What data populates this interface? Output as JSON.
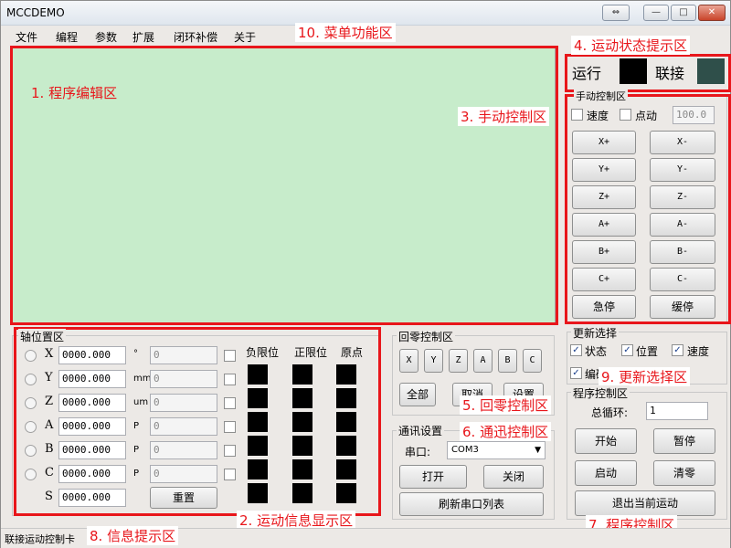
{
  "window": {
    "title": "MCCDEMO",
    "controls": {
      "restore": "⇔",
      "minimize": "—",
      "maximize": "□",
      "close": "✕"
    }
  },
  "menu": [
    "文件",
    "编程",
    "参数",
    "扩展",
    "闭环补偿",
    "关于"
  ],
  "annotations": {
    "menu_area": "10. 菜单功能区",
    "status_area": "4. 运动状态提示区",
    "editor_area": "1. 程序编辑区",
    "manual_area": "3. 手动控制区",
    "motion_info_area": "2. 运动信息显示区",
    "homing_area": "5. 回零控制区",
    "comm_area": "6. 通迅控制区",
    "program_area": "7. 程序控制区",
    "info_area": "8. 信息提示区",
    "update_area": "9. 更新选择区"
  },
  "status": {
    "run_label": "运行",
    "run_color": "#000000",
    "link_label": "联接",
    "link_color": "#2f4f4a"
  },
  "manual": {
    "title": "手动控制区",
    "speed_label": "速度",
    "jog_label": "点动",
    "speed_value": "100.0",
    "buttons": [
      [
        "X+",
        "X-"
      ],
      [
        "Y+",
        "Y-"
      ],
      [
        "Z+",
        "Z-"
      ],
      [
        "A+",
        "A-"
      ],
      [
        "B+",
        "B-"
      ],
      [
        "C+",
        "C-"
      ]
    ],
    "estop": "急停",
    "slow_stop": "缓停"
  },
  "axis": {
    "title": "轴位置区",
    "header_neg": "负限位",
    "header_pos": "正限位",
    "header_origin": "原点",
    "rows": [
      {
        "name": "X",
        "value": "0000.000",
        "unit": "°",
        "set": "0"
      },
      {
        "name": "Y",
        "value": "0000.000",
        "unit": "mm",
        "set": "0"
      },
      {
        "name": "Z",
        "value": "0000.000",
        "unit": "um",
        "set": "0"
      },
      {
        "name": "A",
        "value": "0000.000",
        "unit": "P",
        "set": "0"
      },
      {
        "name": "B",
        "value": "0000.000",
        "unit": "P",
        "set": "0"
      },
      {
        "name": "C",
        "value": "0000.000",
        "unit": "P",
        "set": "0"
      }
    ],
    "s_name": "S",
    "s_value": "0000.000",
    "reset": "重置"
  },
  "homing": {
    "title": "回零控制区",
    "axes": [
      "X",
      "Y",
      "Z",
      "A",
      "B",
      "C"
    ],
    "all": "全部",
    "cancel": "取消",
    "settings": "设置"
  },
  "comm": {
    "title": "通讯设置",
    "port_label": "串口:",
    "port_value": "COM3",
    "open": "打开",
    "close": "关闭",
    "refresh": "刷新串口列表"
  },
  "update": {
    "title": "更新选择",
    "status": "状态",
    "position": "位置",
    "speed": "速度",
    "code": "编码"
  },
  "program": {
    "title": "程序控制区",
    "loop_label": "总循环:",
    "loop_value": "1",
    "start": "开始",
    "pause": "暂停",
    "launch": "启动",
    "clear": "清零",
    "exit": "退出当前运动"
  },
  "statusbar": {
    "text": "联接运动控制卡"
  }
}
